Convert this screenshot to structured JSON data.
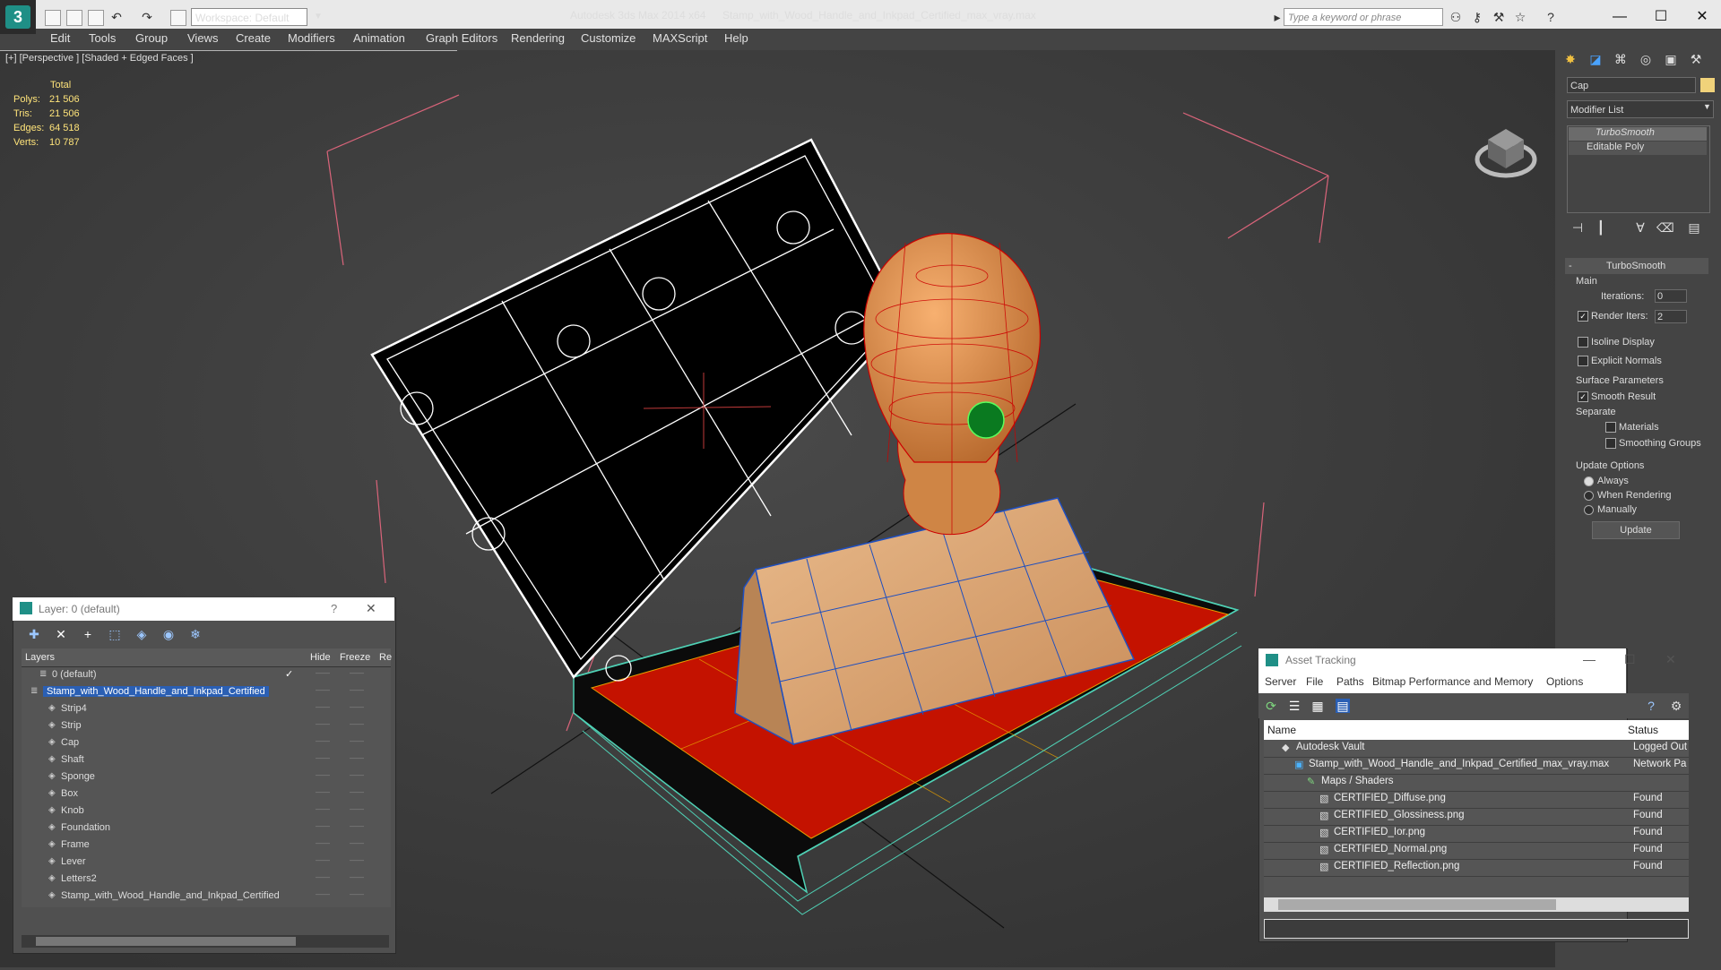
{
  "titlebar": {
    "workspace": "Workspace: Default",
    "app_title": "Autodesk 3ds Max  2014 x64",
    "file_title": "Stamp_with_Wood_Handle_and_Inkpad_Certified_max_vray.max",
    "search_placeholder": "Type a keyword or phrase"
  },
  "menu": [
    "Edit",
    "Tools",
    "Group",
    "Views",
    "Create",
    "Modifiers",
    "Animation",
    "Graph Editors",
    "Rendering",
    "Customize",
    "MAXScript",
    "Help"
  ],
  "viewport": {
    "label": "[+] [Perspective ] [Shaded + Edged Faces ]",
    "stats_header": "Total",
    "stats": [
      {
        "label": "Polys:",
        "value": "21 506"
      },
      {
        "label": "Tris:",
        "value": "21 506"
      },
      {
        "label": "Edges:",
        "value": "64 518"
      },
      {
        "label": "Verts:",
        "value": "10 787"
      }
    ]
  },
  "command_panel": {
    "object_name": "Cap",
    "modifier_list": "Modifier List",
    "stack": [
      "TurboSmooth",
      "Editable Poly"
    ],
    "rollout_title": "TurboSmooth",
    "main_label": "Main",
    "iterations_label": "Iterations:",
    "iterations_value": "0",
    "render_iters_label": "Render Iters:",
    "render_iters_value": "2",
    "isoline_label": "Isoline Display",
    "explicit_normals_label": "Explicit Normals",
    "surface_params_label": "Surface Parameters",
    "smooth_result_label": "Smooth Result",
    "separate_label": "Separate",
    "materials_label": "Materials",
    "smoothing_groups_label": "Smoothing Groups",
    "update_options_label": "Update Options",
    "always_label": "Always",
    "when_rendering_label": "When Rendering",
    "manually_label": "Manually",
    "update_button": "Update",
    "accent_color": "#f0d27a"
  },
  "layer_window": {
    "title": "Layer: 0 (default)",
    "help": "?",
    "col_layers": "Layers",
    "col_hide": "Hide",
    "col_freeze": "Freeze",
    "col_render": "Re",
    "rows": [
      {
        "name": "0 (default)",
        "indent": 1,
        "selected": false,
        "checked": true
      },
      {
        "name": "Stamp_with_Wood_Handle_and_Inkpad_Certified",
        "indent": 0,
        "selected": true,
        "checked": false
      },
      {
        "name": "Strip4",
        "indent": 2,
        "selected": false,
        "checked": false
      },
      {
        "name": "Strip",
        "indent": 2,
        "selected": false,
        "checked": false
      },
      {
        "name": "Cap",
        "indent": 2,
        "selected": false,
        "checked": false
      },
      {
        "name": "Shaft",
        "indent": 2,
        "selected": false,
        "checked": false
      },
      {
        "name": "Sponge",
        "indent": 2,
        "selected": false,
        "checked": false
      },
      {
        "name": "Box",
        "indent": 2,
        "selected": false,
        "checked": false
      },
      {
        "name": "Knob",
        "indent": 2,
        "selected": false,
        "checked": false
      },
      {
        "name": "Foundation",
        "indent": 2,
        "selected": false,
        "checked": false
      },
      {
        "name": "Frame",
        "indent": 2,
        "selected": false,
        "checked": false
      },
      {
        "name": "Lever",
        "indent": 2,
        "selected": false,
        "checked": false
      },
      {
        "name": "Letters2",
        "indent": 2,
        "selected": false,
        "checked": false
      },
      {
        "name": "Stamp_with_Wood_Handle_and_Inkpad_Certified",
        "indent": 2,
        "selected": false,
        "checked": false
      }
    ]
  },
  "asset_window": {
    "title": "Asset Tracking",
    "menu": [
      "Server",
      "File",
      "Paths",
      "Bitmap Performance and Memory",
      "Options"
    ],
    "col_name": "Name",
    "col_status": "Status",
    "rows": [
      {
        "name": "Autodesk Vault",
        "status": "Logged Out",
        "indent": 1
      },
      {
        "name": "Stamp_with_Wood_Handle_and_Inkpad_Certified_max_vray.max",
        "status": "Network Pa",
        "indent": 2
      },
      {
        "name": "Maps / Shaders",
        "status": "",
        "indent": 3
      },
      {
        "name": "CERTIFIED_Diffuse.png",
        "status": "Found",
        "indent": 4
      },
      {
        "name": "CERTIFIED_Glossiness.png",
        "status": "Found",
        "indent": 4
      },
      {
        "name": "CERTIFIED_Ior.png",
        "status": "Found",
        "indent": 4
      },
      {
        "name": "CERTIFIED_Normal.png",
        "status": "Found",
        "indent": 4
      },
      {
        "name": "CERTIFIED_Reflection.png",
        "status": "Found",
        "indent": 4
      }
    ]
  }
}
